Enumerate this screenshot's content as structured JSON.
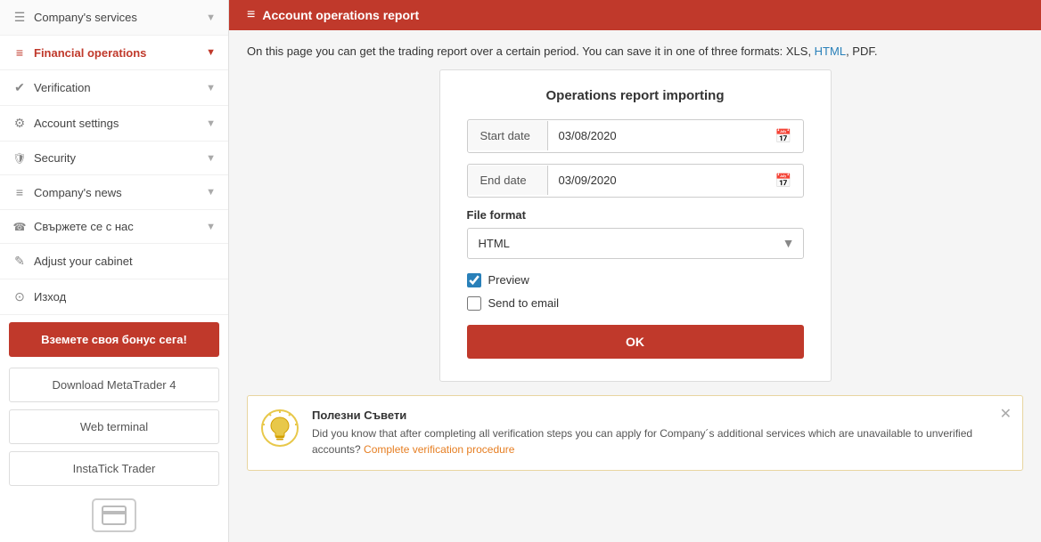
{
  "sidebar": {
    "items": [
      {
        "id": "company-services",
        "label": "Company's services",
        "icon": "☰",
        "active": false,
        "hasChevron": true
      },
      {
        "id": "financial-operations",
        "label": "Financial operations",
        "icon": "≡",
        "active": true,
        "hasChevron": true
      },
      {
        "id": "verification",
        "label": "Verification",
        "icon": "✓",
        "active": false,
        "hasChevron": true
      },
      {
        "id": "account-settings",
        "label": "Account settings",
        "icon": "⚙",
        "active": false,
        "hasChevron": true
      },
      {
        "id": "security",
        "label": "Security",
        "icon": "🛡",
        "active": false,
        "hasChevron": true
      },
      {
        "id": "company-news",
        "label": "Company's news",
        "icon": "≡",
        "active": false,
        "hasChevron": true
      },
      {
        "id": "contact-us",
        "label": "Свържете се с нас",
        "icon": "☎",
        "active": false,
        "hasChevron": true
      },
      {
        "id": "adjust-cabinet",
        "label": "Adjust your cabinet",
        "icon": "✎",
        "active": false,
        "hasChevron": false
      },
      {
        "id": "logout",
        "label": "Изход",
        "icon": "⊙",
        "active": false,
        "hasChevron": false
      }
    ],
    "bonus_button": "Вземете своя бонус сега!",
    "download_mt4": "Download MetaTrader 4",
    "web_terminal": "Web terminal",
    "instatick_trader": "InstaTick Trader"
  },
  "page": {
    "title": "Account operations report",
    "description_text": "On this page you can get the trading report over a certain period. You can save it in one of three formats: XLS, ",
    "description_html_link": "HTML",
    "description_pdf": ", PDF.",
    "form": {
      "title": "Operations report importing",
      "start_date_label": "Start date",
      "start_date_value": "03/08/2020",
      "end_date_label": "End date",
      "end_date_value": "03/09/2020",
      "file_format_label": "File format",
      "file_format_value": "HTML",
      "file_format_options": [
        "XLS",
        "HTML",
        "PDF"
      ],
      "preview_label": "Preview",
      "preview_checked": true,
      "send_to_email_label": "Send to email",
      "send_to_email_checked": false,
      "ok_button": "OK"
    },
    "tips": {
      "title": "Полезни Съвети",
      "text_before": "Did you know that after completing all verification steps you can apply for Company´s additional services which are unavailable to unverified accounts? ",
      "link_text": "Complete verification procedure",
      "link_url": "#"
    }
  }
}
